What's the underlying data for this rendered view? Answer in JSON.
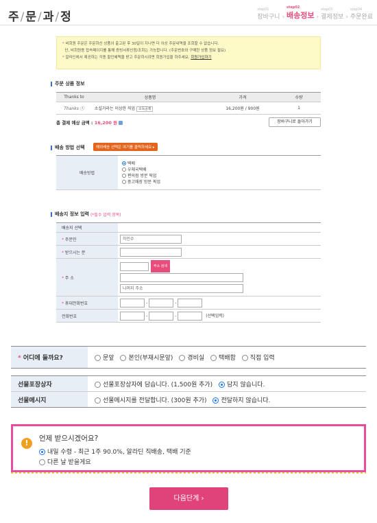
{
  "header": {
    "title_chars": [
      "주",
      "문",
      "과",
      "정"
    ],
    "steps": [
      {
        "num": "step01",
        "label": "장바구니"
      },
      {
        "num": "step02",
        "label": "배송정보"
      },
      {
        "num": "step03",
        "label": "결제정보"
      },
      {
        "num": "step04",
        "label": "주문완료"
      }
    ],
    "active_step_index": 1,
    "step_arrow": "›"
  },
  "notice": {
    "line1": "비회원 주문은 주문하신 상품이 출고된 후 30일이 지나면 더 이상 주문내역을 조회할 수 없습니다.",
    "line2": "단, 비회원용 접속페이지를 통해 증빙서류신청/조회는 가능합니다. (주문번호와 구매한 상품 정보 필요)",
    "line3": "알라딘에서 제공하는 각종 할인혜택을 받고 주문하시려면 회원가입을 하주세요.",
    "link": "회원가입하기"
  },
  "product": {
    "section_title": "주문 상품 정보",
    "headers": [
      "Thanks to",
      "상품명",
      "가격",
      "수량"
    ],
    "rows": [
      {
        "thanks": "Thanks ⓣ",
        "name": "소설가라는 이상한 직업",
        "badge": "소득공제",
        "price": "16,200원 / 900원",
        "qty": "1"
      }
    ],
    "total_label": "총 결제 예상 금액 :",
    "total_amount": "16,200 원",
    "back_button": "장바구니로 돌아가기"
  },
  "shipping": {
    "section_title": "배송 방법 선택",
    "overseas_button": "해외배송 선택은 여기를 클릭하세요 ▸",
    "label": "배송방법",
    "options": [
      "택배",
      "우체국택배",
      "편의점 방문 픽업",
      "중고매장 방문 픽업"
    ],
    "selected_index": 0
  },
  "address": {
    "section_title": "배송지 정보 입력",
    "required_note": "(*필수 입력 항목)",
    "rows": {
      "select_label": "배송지 선택",
      "orderer_label": "주문인",
      "orderer_value": "하민수",
      "recipient_label": "받으시는 분",
      "address_label": "주 소",
      "address_search_button": "주소 검색",
      "address_rest_placeholder": "나머지 주소",
      "mobile_label": "휴대전화번호",
      "phone_label": "전화번호",
      "phone_optional": "(선택입력)",
      "dash": "-"
    }
  },
  "where": {
    "label": "어디에 둘까요?",
    "options": [
      "문앞",
      "본인(부재시문앞)",
      "경비실",
      "택배함",
      "직접 입력"
    ],
    "selected_index": -1
  },
  "gift": {
    "wrap_label": "선물포장상자",
    "wrap_options": [
      "선물포장상자에 담습니다. (1,500원 추가)",
      "담지 않습니다."
    ],
    "wrap_selected": 1,
    "message_label": "선물메시지",
    "message_options": [
      "선물메시지를 전달합니다. (300원 추가)",
      "전달하지 않습니다."
    ],
    "message_selected": 1
  },
  "when": {
    "title": "언제 받으시겠어요?",
    "icon": "!",
    "options": [
      "내일 수령 - 최근 1주 90.0%, 알라딘 직배송, 택배 기준",
      "다른 날 받을게요"
    ],
    "selected_index": 0
  },
  "next_button": "다음단계 ›",
  "colors": {
    "accent": "#e84c7c",
    "label_bg": "#e8eef6",
    "notice_bg": "#fdfac7",
    "orange": "#e3641c"
  }
}
